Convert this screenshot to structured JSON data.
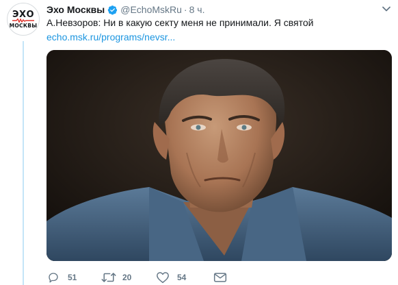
{
  "avatar": {
    "logo_top": "ЭХО",
    "logo_bottom": "МОСКВЫ"
  },
  "tweet": {
    "author_name": "Эхо Москвы",
    "handle": "@EchoMskRu",
    "separator": "·",
    "time": "8 ч.",
    "text": "А.Невзоров: Ни в какую секту меня не принимали. Я святой",
    "link": "echo.msk.ru/programs/nevsr..."
  },
  "actions": {
    "reply_count": "51",
    "retweet_count": "20",
    "like_count": "54"
  },
  "icons": {
    "verified": "verified-badge-icon",
    "caret": "chevron-down-icon",
    "reply": "reply-icon",
    "retweet": "retweet-icon",
    "like": "heart-icon",
    "dm": "envelope-icon"
  },
  "colors": {
    "accent": "#1da1f2",
    "link": "#1b95e0",
    "muted": "#657786",
    "text": "#14171a",
    "thread_line": "#c4e5f8"
  }
}
